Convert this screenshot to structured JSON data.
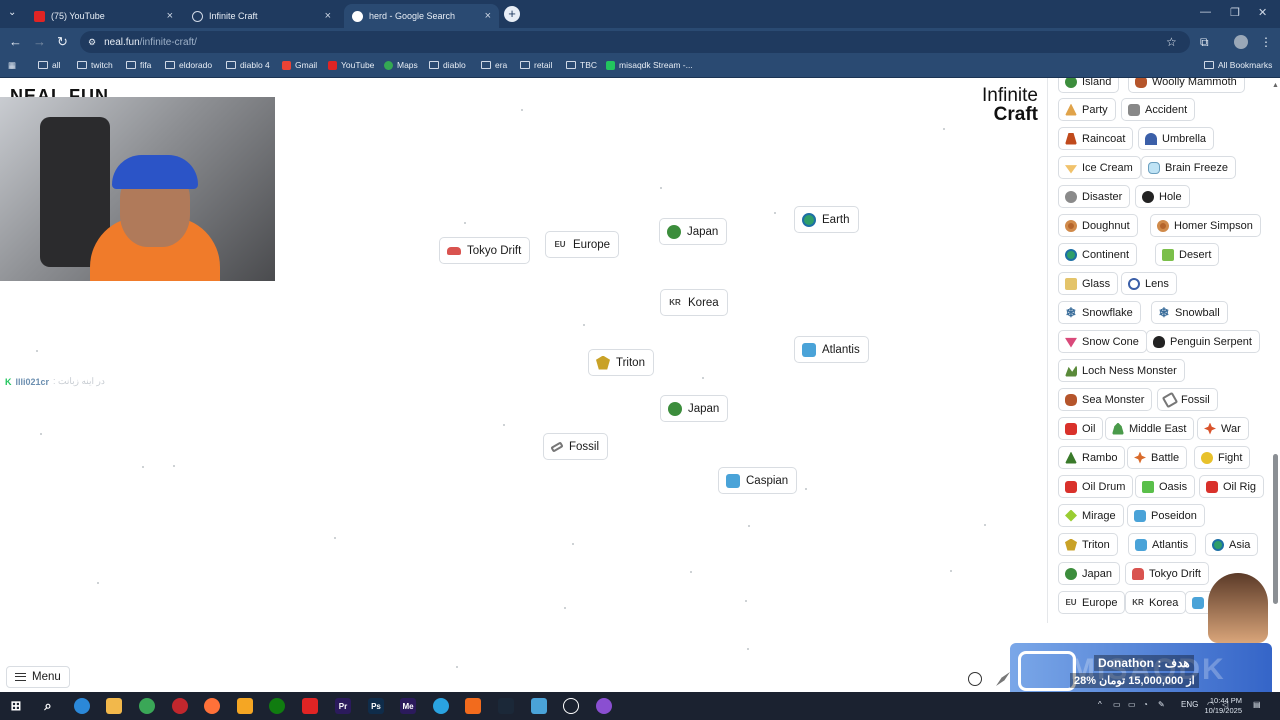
{
  "browser": {
    "tabs": [
      {
        "label": "(75) YouTube",
        "icon": "youtube-icon"
      },
      {
        "label": "Infinite Craft",
        "icon": "site-icon"
      },
      {
        "label": "herd - Google Search",
        "icon": "google-icon"
      }
    ],
    "url_host": "neal.fun",
    "url_path": "/infinite-craft/",
    "bookmarks": [
      "all",
      "twitch",
      "fifa",
      "eldorado",
      "diablo 4",
      "Gmail",
      "YouTube",
      "Maps",
      "diablo",
      "era",
      "retail",
      "TBC",
      "misaqdk Stream -..."
    ],
    "all_bookmarks": "All Bookmarks"
  },
  "page": {
    "brand_line1": "Infinite",
    "brand_line2": "Craft",
    "neal_fun": "NEAL.FUN",
    "menu_label": "Menu",
    "chat": {
      "user": "llli021cr",
      "message": ": در اینه زبانت"
    }
  },
  "canvas_items": [
    {
      "label": "Tokyo Drift",
      "icon": "car"
    },
    {
      "label": "Europe",
      "icon": "text",
      "code": "EU"
    },
    {
      "label": "Japan",
      "icon": "green"
    },
    {
      "label": "Earth",
      "icon": "globe"
    },
    {
      "label": "Korea",
      "icon": "text",
      "code": "KR"
    },
    {
      "label": "Atlantis",
      "icon": "wave"
    },
    {
      "label": "Triton",
      "icon": "trident"
    },
    {
      "label": "Japan",
      "icon": "green"
    },
    {
      "label": "Fossil",
      "icon": "fossil"
    },
    {
      "label": "Caspian",
      "icon": "wave"
    }
  ],
  "sidebar_items": [
    {
      "label": "Island"
    },
    {
      "label": "Woolly Mammoth"
    },
    {
      "label": "Party",
      "icon": "party"
    },
    {
      "label": "Accident",
      "icon": "accident"
    },
    {
      "label": "Raincoat",
      "icon": "raincoat"
    },
    {
      "label": "Umbrella",
      "icon": "umbrella"
    },
    {
      "label": "Ice Cream",
      "icon": "icecream"
    },
    {
      "label": "Brain Freeze",
      "icon": "brain"
    },
    {
      "label": "Disaster",
      "icon": "disaster"
    },
    {
      "label": "Hole",
      "icon": "hole"
    },
    {
      "label": "Doughnut",
      "icon": "donut"
    },
    {
      "label": "Homer Simpson",
      "icon": "donut"
    },
    {
      "label": "Continent",
      "icon": "globe"
    },
    {
      "label": "Desert",
      "icon": "desert"
    },
    {
      "label": "Glass",
      "icon": "glass"
    },
    {
      "label": "Lens",
      "icon": "lens"
    },
    {
      "label": "Snowflake",
      "icon": "snow"
    },
    {
      "label": "Snowball",
      "icon": "snow"
    },
    {
      "label": "Snow Cone",
      "icon": "cone"
    },
    {
      "label": "Penguin Serpent",
      "icon": "penguin"
    },
    {
      "label": "Loch Ness Monster",
      "icon": "loch"
    },
    {
      "label": "Sea Monster",
      "icon": "seamon"
    },
    {
      "label": "Fossil",
      "icon": "fossil"
    },
    {
      "label": "Oil",
      "icon": "oil"
    },
    {
      "label": "Middle East",
      "icon": "mideast"
    },
    {
      "label": "War",
      "icon": "war"
    },
    {
      "label": "Rambo",
      "icon": "rambo"
    },
    {
      "label": "Battle",
      "icon": "battle"
    },
    {
      "label": "Fight",
      "icon": "fight"
    },
    {
      "label": "Oil Drum",
      "icon": "oil"
    },
    {
      "label": "Oasis",
      "icon": "oasis"
    },
    {
      "label": "Oil Rig",
      "icon": "oil"
    },
    {
      "label": "Mirage",
      "icon": "mirage"
    },
    {
      "label": "Poseidon",
      "icon": "wave"
    },
    {
      "label": "Triton",
      "icon": "trident"
    },
    {
      "label": "Atlantis",
      "icon": "wave"
    },
    {
      "label": "Asia",
      "icon": "globe"
    },
    {
      "label": "Japan",
      "icon": "green"
    },
    {
      "label": "Tokyo Drift",
      "icon": "car"
    },
    {
      "label": "Europe",
      "icon": "text",
      "code": "EU"
    },
    {
      "label": "Korea",
      "icon": "text",
      "code": "KR"
    },
    {
      "label": "Ca",
      "icon": "wave"
    }
  ],
  "donation": {
    "title": "Donathon : هدف",
    "amount": "28% از 15,000,000 تومان",
    "watermark": "MISAQDK"
  },
  "taskbar": {
    "lang": "ENG",
    "time": "10:44 PM",
    "date": "10/19/2025"
  }
}
